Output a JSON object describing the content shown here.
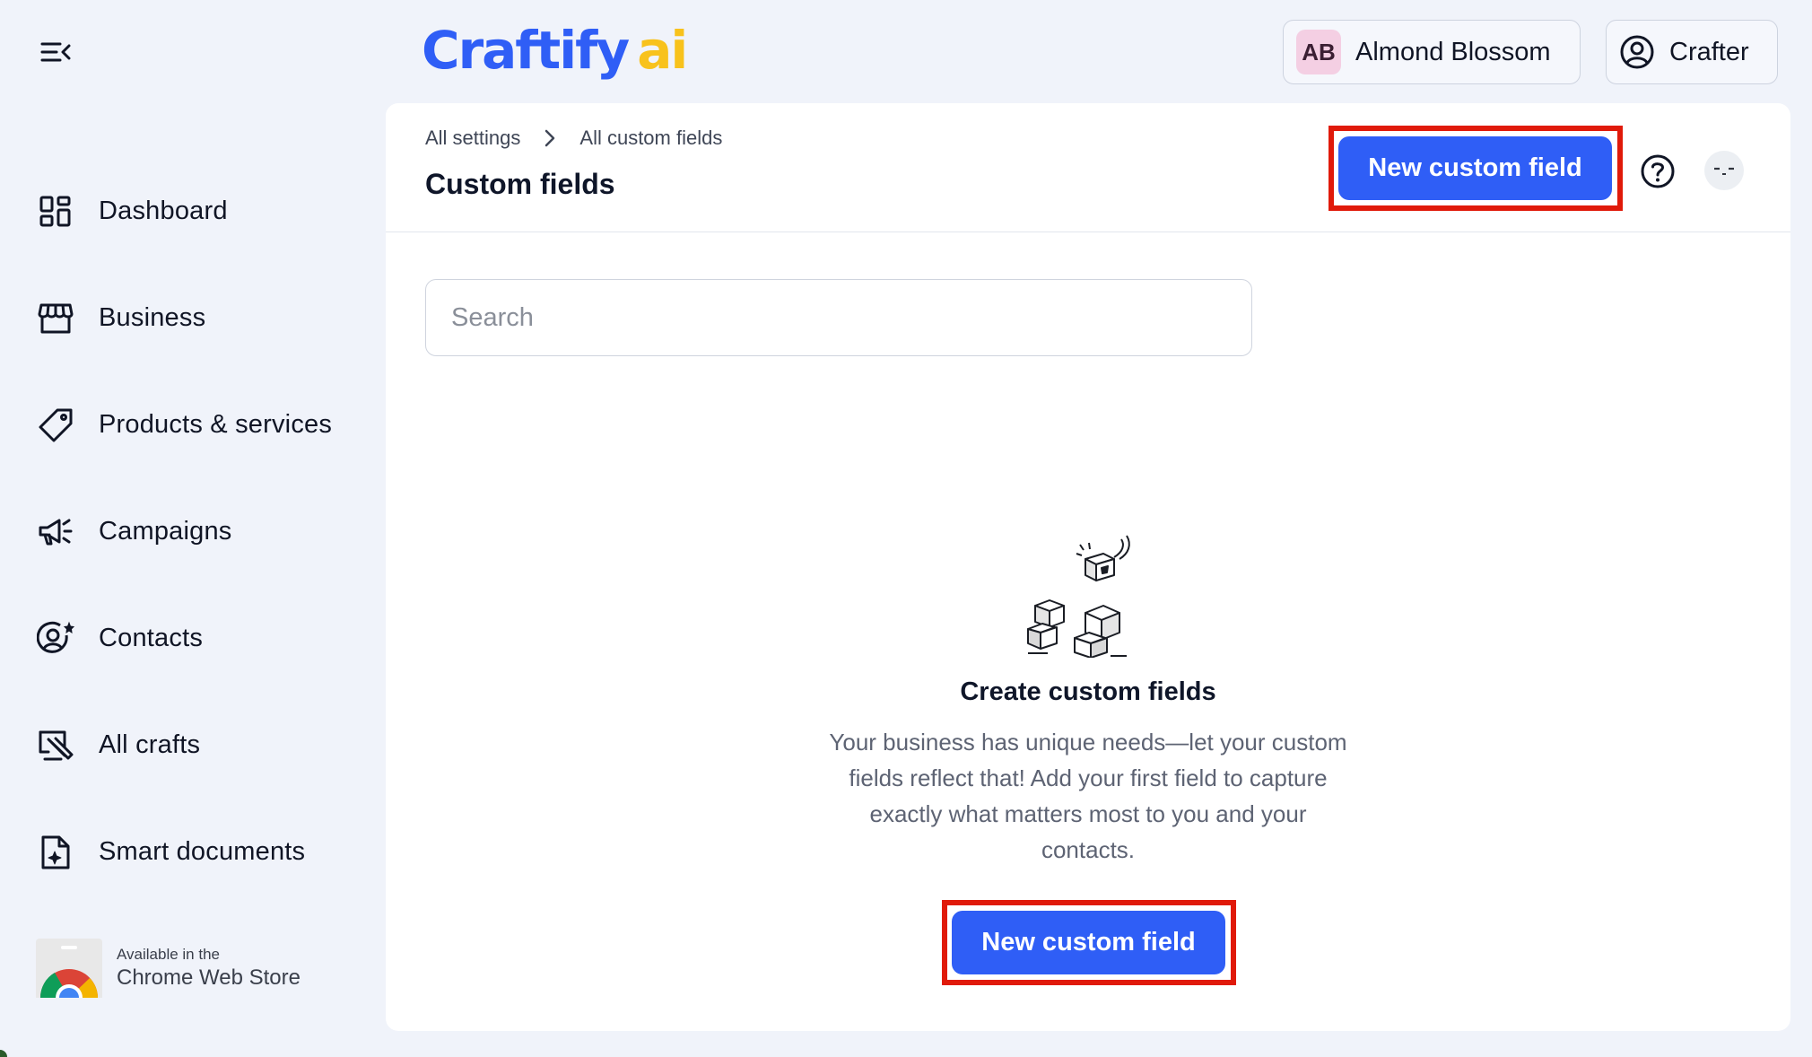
{
  "app": {
    "logo_main": "Craftify",
    "logo_suffix": "ai"
  },
  "header": {
    "workspace_chip": {
      "initials": "AB",
      "name": "Almond Blossom"
    },
    "user_chip": {
      "name": "Crafter",
      "icon": "user-circle-icon"
    }
  },
  "sidebar": {
    "collapse_icon": "sidebar-collapse-icon",
    "items": [
      {
        "label": "Dashboard",
        "icon": "dashboard-grid-icon"
      },
      {
        "label": "Business",
        "icon": "storefront-icon"
      },
      {
        "label": "Products & services",
        "icon": "tag-icon"
      },
      {
        "label": "Campaigns",
        "icon": "megaphone-icon"
      },
      {
        "label": "Contacts",
        "icon": "contact-star-icon"
      },
      {
        "label": "All crafts",
        "icon": "crafts-icon"
      },
      {
        "label": "Smart documents",
        "icon": "smart-document-icon"
      }
    ],
    "chrome_store": {
      "small": "Available in the",
      "big": "Chrome Web Store"
    }
  },
  "main": {
    "breadcrumb": [
      "All settings",
      "All custom fields"
    ],
    "title": "Custom fields",
    "new_button_label": "New custom field",
    "help_icon": "help-circle-icon",
    "search": {
      "placeholder": "Search",
      "value": ""
    },
    "empty_state": {
      "title": "Create custom fields",
      "description": "Your business has unique needs—let your custom fields reflect that! Add your first field to capture exactly what matters most to you and your contacts.",
      "button_label": "New custom field"
    }
  },
  "colors": {
    "accent": "#2f5ef6",
    "logo_ai": "#f8c21c",
    "highlight": "#e01a0a",
    "background": "#f0f3fa"
  }
}
